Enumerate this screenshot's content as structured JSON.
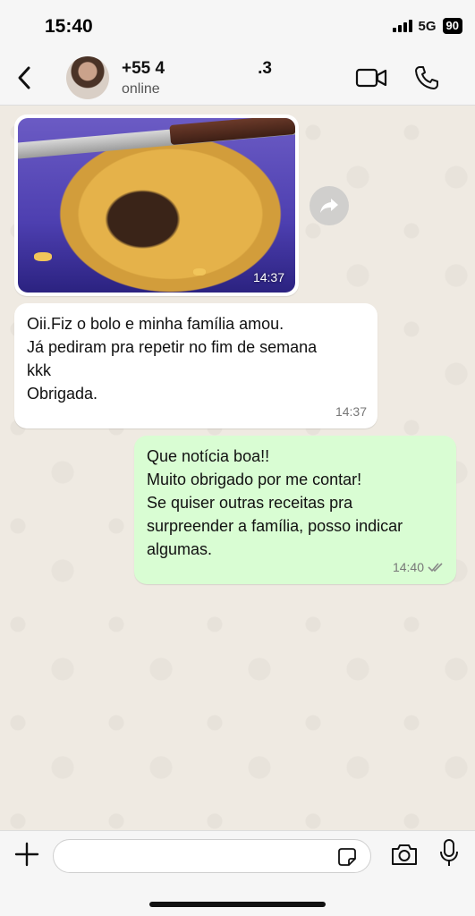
{
  "status_bar": {
    "time": "15:40",
    "network": "5G",
    "battery": "90"
  },
  "header": {
    "contact_name": "+55 4",
    "contact_suffix": ".3",
    "status": "online"
  },
  "messages": [
    {
      "type": "image",
      "direction": "incoming",
      "time": "14:37"
    },
    {
      "type": "text",
      "direction": "incoming",
      "lines": [
        "Oii.Fiz o bolo e minha família amou.",
        "Já pediram pra repetir no fim de semana",
        "kkk",
        "Obrigada."
      ],
      "time": "14:37"
    },
    {
      "type": "text",
      "direction": "outgoing",
      "lines": [
        "Que notícia boa!!",
        "Muito obrigado por me contar!",
        "Se quiser outras receitas pra",
        "surpreender a família, posso indicar",
        "algumas."
      ],
      "time": "14:40",
      "read": true
    }
  ],
  "composer": {
    "placeholder": ""
  },
  "colors": {
    "outgoing_bubble": "#d9fdd3",
    "incoming_bubble": "#ffffff",
    "background": "#efeae2",
    "read_tick": "#888888"
  },
  "icons": [
    "back-icon",
    "video-call-icon",
    "phone-icon",
    "forward-icon",
    "plus-icon",
    "sticker-icon",
    "camera-icon",
    "mic-icon",
    "double-check-icon"
  ]
}
